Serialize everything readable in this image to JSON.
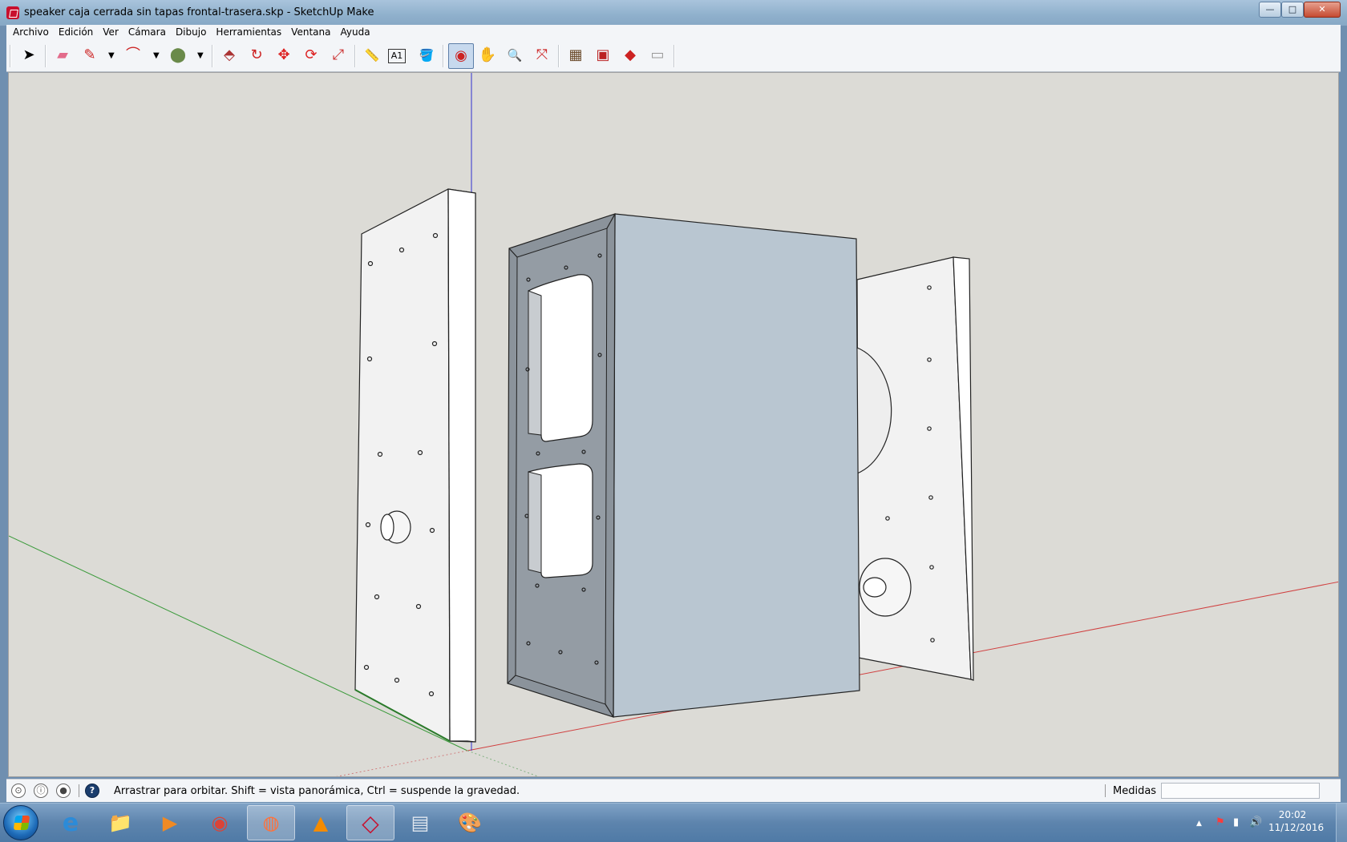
{
  "window": {
    "title": "speaker caja cerrada sin tapas frontal-trasera.skp - SketchUp Make",
    "controls": {
      "minimize": "—",
      "maximize": "□",
      "close": "✕"
    }
  },
  "menu": [
    "Archivo",
    "Edición",
    "Ver",
    "Cámara",
    "Dibujo",
    "Herramientas",
    "Ventana",
    "Ayuda"
  ],
  "toolbar": {
    "tools": [
      {
        "icon": "select-icon",
        "glyph": "➤"
      },
      {
        "icon": "eraser-icon",
        "glyph": "▰"
      },
      {
        "icon": "pencil-icon",
        "glyph": "✎"
      },
      {
        "icon": "arc-icon",
        "glyph": "⌒"
      },
      {
        "icon": "shape-icon",
        "glyph": "⬤"
      },
      {
        "icon": "push-pull-icon",
        "glyph": "⬘"
      },
      {
        "icon": "follow-me-icon",
        "glyph": "↻"
      },
      {
        "icon": "move-icon",
        "glyph": "✥"
      },
      {
        "icon": "rotate-icon",
        "glyph": "⟳"
      },
      {
        "icon": "scale-icon",
        "glyph": "⤢"
      },
      {
        "icon": "tape-measure-icon",
        "glyph": "📏"
      },
      {
        "icon": "text-icon",
        "glyph": "A1"
      },
      {
        "icon": "paint-bucket-icon",
        "glyph": "🪣"
      },
      {
        "icon": "orbit-icon",
        "glyph": "◉"
      },
      {
        "icon": "pan-icon",
        "glyph": "✋"
      },
      {
        "icon": "zoom-icon",
        "glyph": "🔍"
      },
      {
        "icon": "zoom-extents-icon",
        "glyph": "⤧"
      },
      {
        "icon": "warehouse-icon",
        "glyph": "▦"
      },
      {
        "icon": "components-icon",
        "glyph": "▣"
      },
      {
        "icon": "extension-icon",
        "glyph": "◆"
      },
      {
        "icon": "layout-icon",
        "glyph": "▭"
      }
    ],
    "active_tool": "orbit-icon"
  },
  "status": {
    "message": "Arrastrar para orbitar. Shift = vista panorámica, Ctrl = suspende la gravedad.",
    "measure_label": "Medidas",
    "measure_value": "",
    "help_glyph": "?",
    "icons": [
      "geolocation-icon",
      "credits-icon",
      "user-icon",
      "help-icon"
    ]
  },
  "taskbar": {
    "apps": [
      {
        "icon": "internet-explorer-icon",
        "glyph": "e",
        "color": "#2c8bd8"
      },
      {
        "icon": "file-explorer-icon",
        "glyph": "📁",
        "color": "#e7c24b"
      },
      {
        "icon": "media-player-icon",
        "glyph": "▶",
        "color": "#f08a24"
      },
      {
        "icon": "chrome-icon",
        "glyph": "◉",
        "color": "#db4437"
      },
      {
        "icon": "firefox-icon",
        "glyph": "◍",
        "color": "#ff7139"
      },
      {
        "icon": "vlc-icon",
        "glyph": "▲",
        "color": "#f48b00"
      },
      {
        "icon": "sketchup-icon",
        "glyph": "◇",
        "color": "#c8102e"
      },
      {
        "icon": "calculator-icon",
        "glyph": "▤",
        "color": "#8aa0b8"
      },
      {
        "icon": "paint-icon",
        "glyph": "🎨",
        "color": "#d9a441"
      }
    ],
    "active_apps": [
      "firefox-icon",
      "sketchup-icon"
    ],
    "clock_time": "20:02",
    "clock_date": "11/12/2016",
    "tray": {
      "up": "▲",
      "flag": "⚑",
      "signal": "▮",
      "volume": "🔊"
    }
  },
  "colors": {
    "viewport_bg": "#dcdbd6",
    "box_side": "#b9c6d1",
    "box_front": "#8b939b",
    "panel_face": "#f2f2f2",
    "axis_red": "#d04040",
    "axis_green": "#3a9a3a",
    "axis_blue": "#3030d0"
  }
}
